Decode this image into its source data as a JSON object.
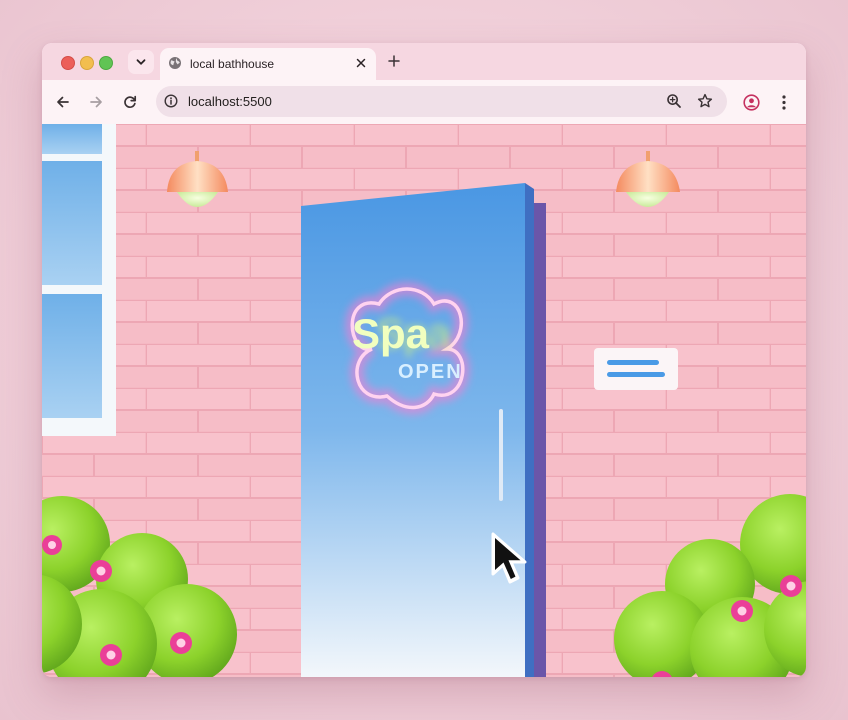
{
  "browser": {
    "tab": {
      "title": "local bathhouse",
      "favicon": "globe-icon"
    },
    "url": "localhost:5500",
    "toolbar_icons": [
      "back-arrow-icon",
      "forward-arrow-icon",
      "reload-icon",
      "info-icon",
      "zoom-icon",
      "star-icon",
      "profile-icon",
      "kebab-menu-icon"
    ]
  },
  "page": {
    "neon_sign": {
      "word": "Spa",
      "status": "OPEN"
    },
    "colors": {
      "wall": "#f5b7c2",
      "door": "#4f9ee6",
      "neon_yellow": "#e4ff6a",
      "neon_pink": "#ff7ad0",
      "bush": "#8bd12a",
      "flower": "#ea3f98"
    }
  }
}
